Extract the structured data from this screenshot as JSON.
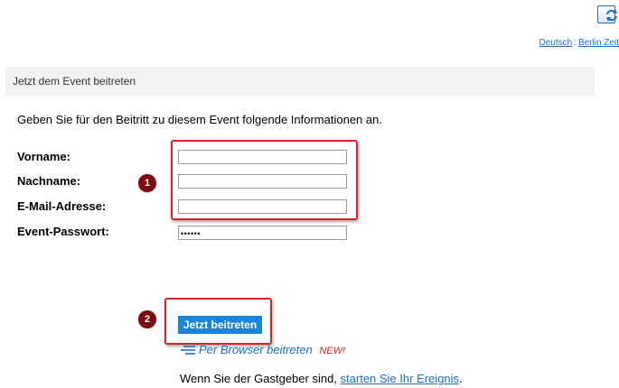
{
  "toolbar": {
    "refresh_icon": "refresh-icon"
  },
  "locale": {
    "language": "Deutsch",
    "separator": ":",
    "timezone": "Berlin Zeit"
  },
  "header": {
    "title": "Jetzt dem Event beitreten"
  },
  "form": {
    "intro": "Geben Sie für den Beitritt zu diesem Event folgende Informationen an.",
    "first_name_label": "Vorname:",
    "first_name_value": "",
    "last_name_label": "Nachname:",
    "last_name_value": "",
    "email_label": "E-Mail-Adresse:",
    "email_value": "",
    "password_label": "Event-Passwort:",
    "password_masked": "••••••"
  },
  "annotations": {
    "step1": "1",
    "step2": "2",
    "highlight_color": "#d9242b",
    "badge_color": "#7a0c12"
  },
  "actions": {
    "join_label": "Jetzt beitreten",
    "browser_join_label": "Per Browser beitreten",
    "new_label": "NEW!",
    "host_prefix": "Wenn Sie der Gastgeber sind, ",
    "host_link": "starten Sie Ihr Ereignis",
    "host_suffix": "."
  }
}
